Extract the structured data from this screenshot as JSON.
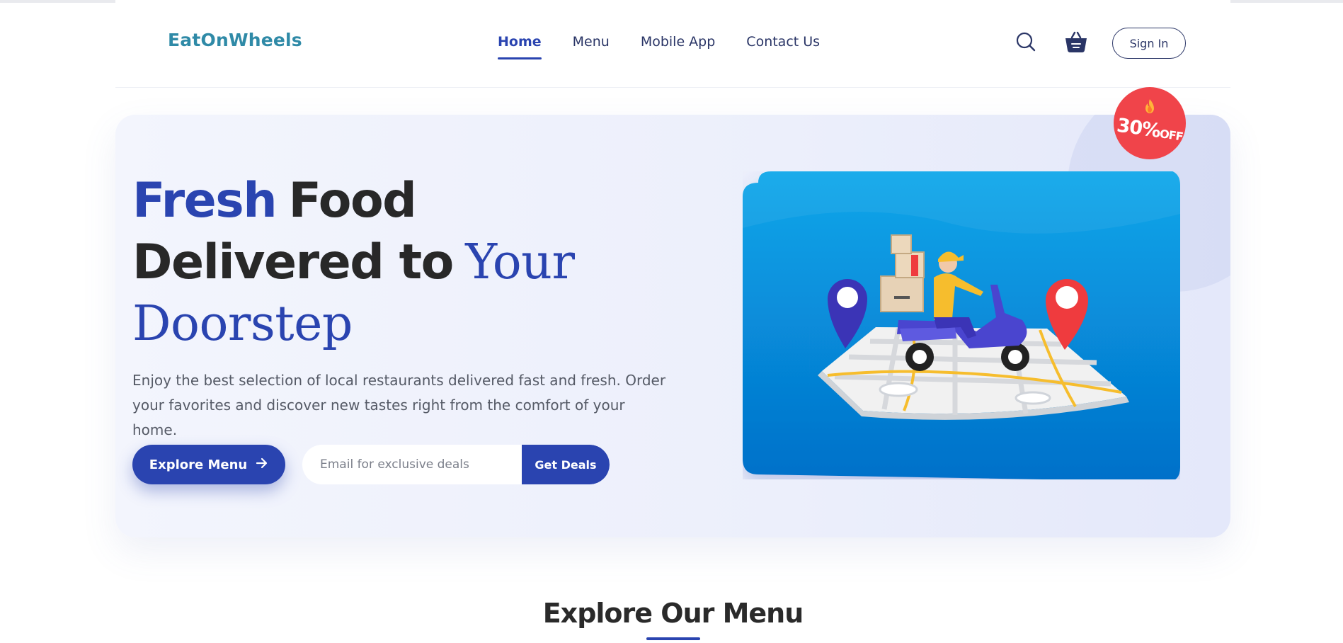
{
  "header": {
    "logo": "EatOnWheels",
    "nav": [
      {
        "label": "Home",
        "active": true
      },
      {
        "label": "Menu",
        "active": false
      },
      {
        "label": "Mobile App",
        "active": false
      },
      {
        "label": "Contact Us",
        "active": false
      }
    ],
    "icons": [
      "search-icon",
      "basket-icon"
    ],
    "sign_in": "Sign In"
  },
  "hero": {
    "title_fresh": "Fresh",
    "title_food": "Food",
    "title_delivered": "Delivered to",
    "title_your": "Your",
    "title_doorstep": "Doorstep",
    "lead": "Enjoy the best selection of local restaurants delivered fast and fresh. Order your favorites and discover new tastes right from the comfort of your home.",
    "explore_button": "Explore Menu",
    "email_placeholder": "Email for exclusive deals",
    "deals_button": "Get Deals",
    "badge_percent": "30%",
    "badge_off": "OFF",
    "badge_icon": "fire-icon"
  },
  "section": {
    "title": "Explore Our Menu"
  },
  "colors": {
    "brand": "#2a44b0",
    "logo": "#2f8aa7",
    "badge": "#f0444a",
    "card_blue": "#0a8fe0"
  }
}
